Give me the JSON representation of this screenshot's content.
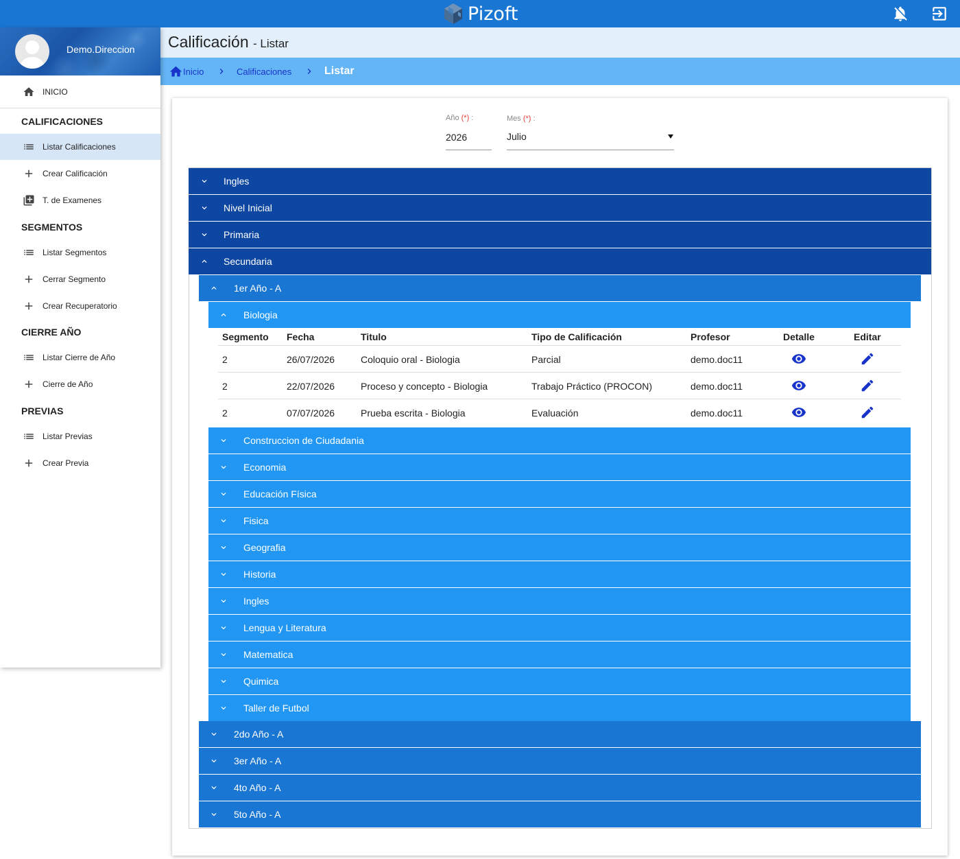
{
  "app": {
    "brand": "Pizoft"
  },
  "user": {
    "name": "Demo.Direccion"
  },
  "sidebar": {
    "home": "INICIO",
    "sections": [
      {
        "title": "CALIFICACIONES",
        "items": [
          {
            "label": "Listar Calificaciones",
            "icon": "list-icon"
          },
          {
            "label": "Crear Calificación",
            "icon": "plus-icon"
          },
          {
            "label": "T. de Examenes",
            "icon": "library-add-icon"
          }
        ]
      },
      {
        "title": "SEGMENTOS",
        "items": [
          {
            "label": "Listar Segmentos",
            "icon": "list-icon"
          },
          {
            "label": "Cerrar Segmento",
            "icon": "plus-icon"
          },
          {
            "label": "Crear Recuperatorio",
            "icon": "plus-icon"
          }
        ]
      },
      {
        "title": "CIERRE AÑO",
        "items": [
          {
            "label": "Listar Cierre de Año",
            "icon": "list-icon"
          },
          {
            "label": "Cierre de Año",
            "icon": "plus-icon"
          }
        ]
      },
      {
        "title": "PREVIAS",
        "items": [
          {
            "label": "Listar Previas",
            "icon": "list-icon"
          },
          {
            "label": "Crear Previa",
            "icon": "plus-icon"
          }
        ]
      }
    ]
  },
  "header": {
    "title": "Calificación",
    "subtitle": "- Listar"
  },
  "breadcrumb": {
    "home": "Inicio",
    "section": "Calificaciones",
    "current": "Listar"
  },
  "filters": {
    "year_label": "Año",
    "month_label": "Mes",
    "required_mark": "(*)",
    "colon": ":",
    "year_value": "2026",
    "month_value": "Julio"
  },
  "levels": [
    "Ingles",
    "Nivel Inicial",
    "Primaria",
    "Secundaria"
  ],
  "secundaria": {
    "open_course": "1er Año - A",
    "open_subject": "Biologia",
    "table": {
      "headers": [
        "Segmento",
        "Fecha",
        "Titulo",
        "Tipo de Calificación",
        "Profesor",
        "Detalle",
        "Editar"
      ],
      "rows": [
        [
          "2",
          "26/07/2026",
          "Coloquio oral - Biologia",
          "Parcial",
          "demo.doc11"
        ],
        [
          "2",
          "22/07/2026",
          "Proceso y concepto - Biologia",
          "Trabajo Práctico (PROCON)",
          "demo.doc11"
        ],
        [
          "2",
          "07/07/2026",
          "Prueba escrita - Biologia",
          "Evaluación",
          "demo.doc11"
        ]
      ]
    },
    "other_subjects": [
      "Construccion de Ciudadania",
      "Economia",
      "Educación Física",
      "Fisica",
      "Geografia",
      "Historia",
      "Ingles",
      "Lengua y Literatura",
      "Matematica",
      "Quimica",
      "Taller de Futbol"
    ],
    "other_courses": [
      "2do Año - A",
      "3er Año - A",
      "4to Año - A",
      "5to Año - A"
    ]
  },
  "colors": {
    "topbar": "#1976d2",
    "level": "#0d47a1",
    "course": "#1976d2",
    "subject": "#2196f3",
    "action": "#1733c9"
  }
}
